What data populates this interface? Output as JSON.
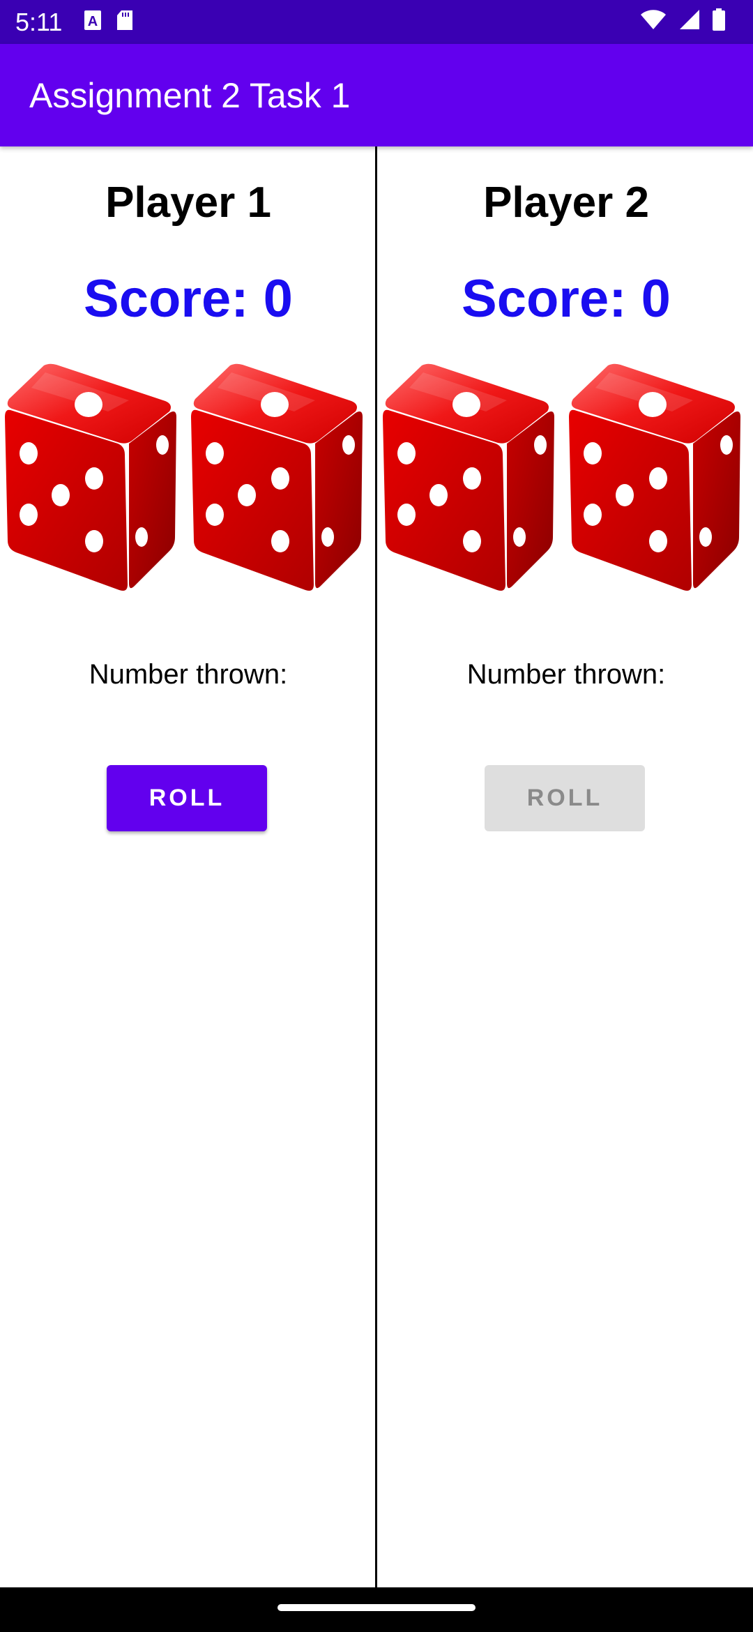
{
  "status_bar": {
    "time": "5:11",
    "left_icons": [
      "a-notification-icon",
      "sd-card-icon"
    ],
    "right_icons": [
      "wifi-icon",
      "signal-icon",
      "battery-icon"
    ]
  },
  "app_bar": {
    "title": "Assignment 2 Task 1"
  },
  "players": [
    {
      "name": "Player 1",
      "score": "Score: 0",
      "dice": [
        5,
        5
      ],
      "number_thrown": "Number thrown:",
      "roll_label": "ROLL",
      "roll_enabled": true
    },
    {
      "name": "Player 2",
      "score": "Score: 0",
      "dice": [
        5,
        5
      ],
      "number_thrown": "Number thrown:",
      "roll_label": "ROLL",
      "roll_enabled": false
    }
  ],
  "colors": {
    "status_bar": "#3a00b3",
    "app_bar": "#6200ee",
    "score_text": "#1a0df0",
    "die_red": "#d80000",
    "roll_disabled_bg": "#dedede"
  }
}
